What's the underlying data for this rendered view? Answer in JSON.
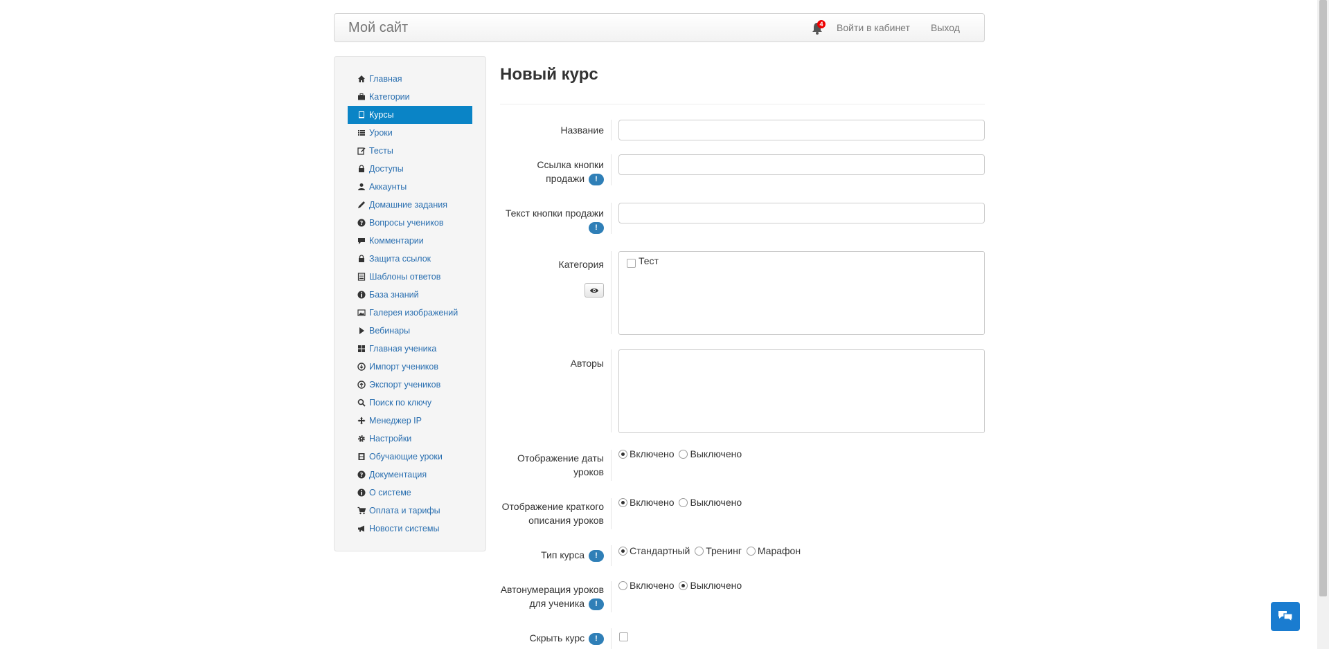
{
  "navbar": {
    "brand": "Мой сайт",
    "notification_count": "4",
    "cabinet_link": "Войти в кабинет",
    "exit_link": "Выход",
    "bell_icon": "bell-icon"
  },
  "sidebar": {
    "items": [
      {
        "label": "Главная",
        "icon": "home-icon"
      },
      {
        "label": "Категории",
        "icon": "briefcase-icon"
      },
      {
        "label": "Курсы",
        "icon": "book-icon",
        "active": true
      },
      {
        "label": "Уроки",
        "icon": "list-icon"
      },
      {
        "label": "Тесты",
        "icon": "edit-icon"
      },
      {
        "label": "Доступы",
        "icon": "lock-icon"
      },
      {
        "label": "Аккаунты",
        "icon": "user-icon"
      },
      {
        "label": "Домашние задания",
        "icon": "pencil-icon"
      },
      {
        "label": "Вопросы учеников",
        "icon": "question-icon"
      },
      {
        "label": "Комментарии",
        "icon": "comment-icon"
      },
      {
        "label": "Защита ссылок",
        "icon": "lock-icon"
      },
      {
        "label": "Шаблоны ответов",
        "icon": "template-icon"
      },
      {
        "label": "База знаний",
        "icon": "info-icon"
      },
      {
        "label": "Галерея изображений",
        "icon": "picture-icon"
      },
      {
        "label": "Вебинары",
        "icon": "play-icon"
      },
      {
        "label": "Главная ученика",
        "icon": "grid-icon"
      },
      {
        "label": "Импорт учеников",
        "icon": "import-icon"
      },
      {
        "label": "Экспорт учеников",
        "icon": "export-icon"
      },
      {
        "label": "Поиск по ключу",
        "icon": "search-icon"
      },
      {
        "label": "Менеджер IP",
        "icon": "move-icon"
      },
      {
        "label": "Настройки",
        "icon": "gear-icon"
      },
      {
        "label": "Обучающие уроки",
        "icon": "film-icon"
      },
      {
        "label": "Документация",
        "icon": "question-icon"
      },
      {
        "label": "О системе",
        "icon": "info-icon"
      },
      {
        "label": "Оплата и тарифы",
        "icon": "cart-icon"
      },
      {
        "label": "Новости системы",
        "icon": "bullhorn-icon"
      }
    ]
  },
  "form": {
    "title": "Новый курс",
    "name_label": "Название",
    "sell_link_label_1": "Ссылка кнопки",
    "sell_link_label_2": "продажи",
    "sell_text_label": "Текст кнопки продажи",
    "category_label": "Категория",
    "category_option": "Тест",
    "authors_label": "Авторы",
    "date_display_label_1": "Отображение даты",
    "date_display_label_2": "уроков",
    "short_desc_label_1": "Отображение краткого",
    "short_desc_label_2": "описания уроков",
    "course_type_label": "Тип курса",
    "autonum_label_1": "Автонумерация уроков",
    "autonum_label_2": "для ученика",
    "hide_label": "Скрыть курс",
    "info_mark": "!",
    "opt_on": "Включено",
    "opt_off": "Выключено",
    "type_standard": "Стандартный",
    "type_training": "Тренинг",
    "type_marathon": "Марафон"
  },
  "chat": {
    "icon": "chat-icon"
  }
}
